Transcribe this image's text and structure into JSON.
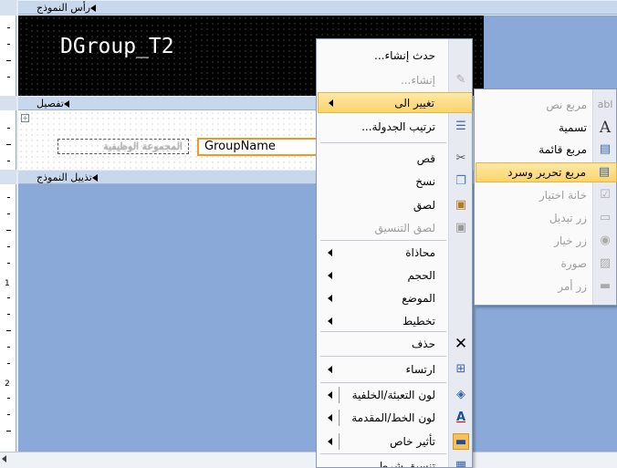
{
  "form": {
    "sections": {
      "header": "رأس النموذج",
      "detail": "تفصيل",
      "footer": "تذييل النموذج"
    },
    "title_control": "DGroup_T2",
    "detail_label": "المجموعة الوظيفية",
    "detail_field": "GroupName"
  },
  "ruler": {
    "numbers": [
      "1",
      "2"
    ]
  },
  "context_menu": {
    "items": [
      {
        "label": "حدث إنشاء...",
        "icon": "none",
        "disabled": false,
        "submenu": false
      },
      {
        "label": "إنشاء...",
        "icon": "builder-wand-icon",
        "disabled": true,
        "submenu": false
      },
      {
        "label": "تغيير الى",
        "icon": "none",
        "disabled": false,
        "submenu": true,
        "highlighted": true
      },
      {
        "label": "ترتيب الجدولة...",
        "icon": "tab-order-icon",
        "disabled": false,
        "submenu": false
      },
      {
        "label": "قص",
        "icon": "scissors-icon",
        "disabled": false,
        "submenu": false
      },
      {
        "label": "نسخ",
        "icon": "copy-icon",
        "disabled": false,
        "submenu": false
      },
      {
        "label": "لصق",
        "icon": "paste-icon",
        "disabled": false,
        "submenu": false
      },
      {
        "label": "لصق التنسيق",
        "icon": "paste-format-icon",
        "disabled": true,
        "submenu": false
      },
      {
        "label": "محاذاة",
        "icon": "none",
        "disabled": false,
        "submenu": true
      },
      {
        "label": "الحجم",
        "icon": "none",
        "disabled": false,
        "submenu": true
      },
      {
        "label": "الموضع",
        "icon": "none",
        "disabled": false,
        "submenu": true
      },
      {
        "label": "تخطيط",
        "icon": "none",
        "disabled": false,
        "submenu": true
      },
      {
        "label": "حذف",
        "icon": "delete-x-icon",
        "disabled": false,
        "submenu": false
      },
      {
        "label": "ارتساء",
        "icon": "anchor-icon",
        "disabled": false,
        "submenu": true
      },
      {
        "label": "لون التعبئة/الخلفية",
        "icon": "fill-color-icon",
        "disabled": false,
        "submenu": true
      },
      {
        "label": "لون الخط/المقدمة",
        "icon": "font-color-icon",
        "disabled": false,
        "submenu": true
      },
      {
        "label": "تأثير خاص",
        "icon": "special-effect-icon",
        "disabled": false,
        "submenu": true
      },
      {
        "label": "تنسيق شرطي...",
        "icon": "conditional-format-icon",
        "disabled": false,
        "submenu": false
      }
    ]
  },
  "submenu": {
    "items": [
      {
        "label": "مربع نص",
        "icon": "text-box-icon",
        "disabled": true
      },
      {
        "label": "تسمية",
        "icon": "label-a-icon",
        "disabled": false
      },
      {
        "label": "مربع قائمة",
        "icon": "list-box-icon",
        "disabled": false
      },
      {
        "label": "مربع تحرير وسرد",
        "icon": "combo-box-icon",
        "disabled": false,
        "highlighted": true
      },
      {
        "label": "خانة اختيار",
        "icon": "checkbox-icon",
        "disabled": true
      },
      {
        "label": "زر تبديل",
        "icon": "toggle-button-icon",
        "disabled": true
      },
      {
        "label": "زر خيار",
        "icon": "option-button-icon",
        "disabled": true
      },
      {
        "label": "صورة",
        "icon": "image-icon",
        "disabled": true
      },
      {
        "label": "زر أمر",
        "icon": "command-button-icon",
        "disabled": true
      }
    ]
  },
  "colors": {
    "menu_highlight": "#fbd46a",
    "selection_border": "#f19a22",
    "section_bar": "#c7d7ec",
    "design_background": "#8aa9d8"
  }
}
